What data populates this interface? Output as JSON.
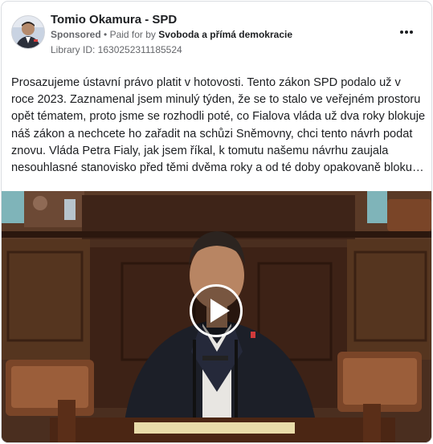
{
  "ad": {
    "advertiser_name": "Tomio Okamura - SPD",
    "sponsored_label": "Sponsored",
    "separator": "•",
    "paid_for_by_prefix": "Paid for by",
    "payer": "Svoboda a přímá demokracie",
    "library_id": "Library ID: 1630252311185524",
    "more_options_icon": "more-horizontal-icon",
    "body_text": "Prosazujeme ústavní právo platit v hotovosti. Tento zákon SPD podalo už v roce 2023. Zaznamenal jsem minulý týden, že se to stalo ve veřejném prostoru opět tématem, proto jsme se rozhodli poté, co Fialova vláda už dva roky blokuje náš zákon a nechcete ho zařadit na schůzi Sněmovny, chci tento návrh podat znovu. Vláda Petra Fialy, jak jsem říkal, k tomutu našemu návrhu zaujala nesouhlasné stanovisko před těmi dvěma roky a od té doby opakovaně blokuje jeho zařazení na program jednání Sněmovny. Návrh SPD na ústavní ochranu plateb v hotovosti…",
    "video": {
      "play_icon": "play-icon"
    }
  },
  "colors": {
    "text_primary": "#1c1e21",
    "text_secondary": "#65676b",
    "border": "#dadde1"
  }
}
